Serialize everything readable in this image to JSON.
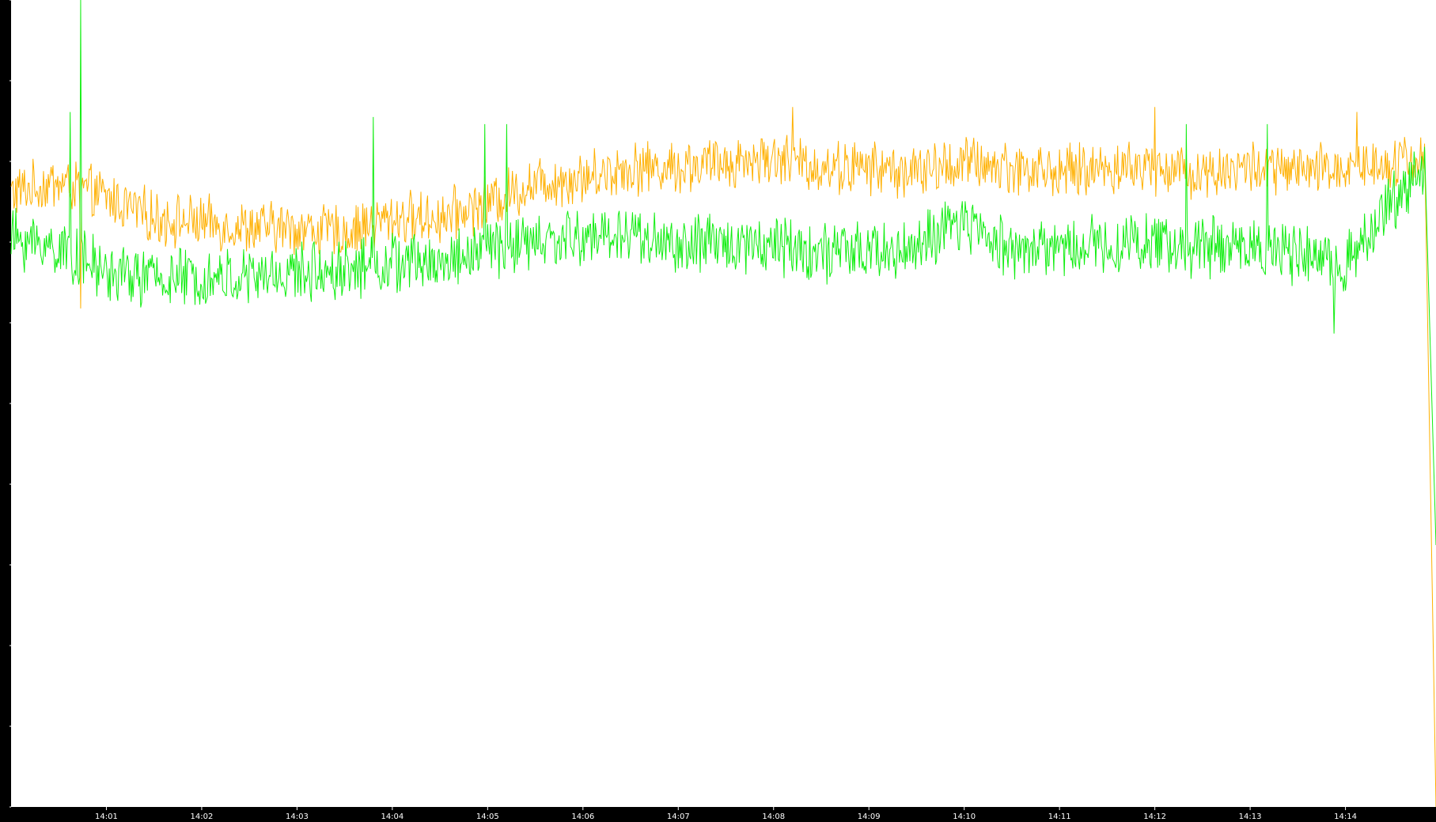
{
  "chart_data": {
    "type": "line",
    "title": "",
    "xlabel": "",
    "ylabel": "",
    "ylim": [
      0,
      8012
    ],
    "y_ticks": [
      "0",
      "801",
      "1602",
      "2403",
      "3204",
      "4006",
      "4807",
      "5608",
      "6409",
      "7210",
      "8012"
    ],
    "x_ticks": [
      "14:01",
      "14:02",
      "14:03",
      "14:04",
      "14:05",
      "14:06",
      "14:07",
      "14:08",
      "14:09",
      "14:10",
      "14:11",
      "14:12",
      "14:13",
      "14:14"
    ],
    "x_range": [
      "14:00:00",
      "14:14:57"
    ],
    "grid": false,
    "legend": "none",
    "series": [
      {
        "color": "#ffb000",
        "profile": [
          [
            "14:00:00",
            6100
          ],
          [
            "14:00:30",
            6200
          ],
          [
            "14:01:00",
            6050
          ],
          [
            "14:01:30",
            5850
          ],
          [
            "14:02:00",
            5800
          ],
          [
            "14:02:30",
            5750
          ],
          [
            "14:03:00",
            5750
          ],
          [
            "14:03:30",
            5700
          ],
          [
            "14:04:00",
            5850
          ],
          [
            "14:04:30",
            5850
          ],
          [
            "14:05:00",
            6000
          ],
          [
            "14:05:30",
            6200
          ],
          [
            "14:06:00",
            6250
          ],
          [
            "14:06:30",
            6350
          ],
          [
            "14:07:00",
            6350
          ],
          [
            "14:07:30",
            6400
          ],
          [
            "14:08:00",
            6450
          ],
          [
            "14:08:30",
            6350
          ],
          [
            "14:09:00",
            6350
          ],
          [
            "14:09:30",
            6300
          ],
          [
            "14:10:00",
            6400
          ],
          [
            "14:10:30",
            6350
          ],
          [
            "14:11:00",
            6300
          ],
          [
            "14:11:30",
            6350
          ],
          [
            "14:12:00",
            6350
          ],
          [
            "14:12:30",
            6300
          ],
          [
            "14:13:00",
            6350
          ],
          [
            "14:13:30",
            6300
          ],
          [
            "14:14:00",
            6350
          ],
          [
            "14:14:50",
            6450
          ],
          [
            "14:14:57",
            0
          ]
        ],
        "spikes": [
          [
            "14:00:44",
            4950
          ],
          [
            "14:08:12",
            6950
          ],
          [
            "14:12:00",
            6950
          ],
          [
            "14:14:07",
            6900
          ]
        ]
      },
      {
        "color": "#11ee11",
        "profile": [
          [
            "14:00:00",
            5650
          ],
          [
            "14:00:30",
            5550
          ],
          [
            "14:01:00",
            5300
          ],
          [
            "14:01:30",
            5250
          ],
          [
            "14:02:00",
            5250
          ],
          [
            "14:02:30",
            5250
          ],
          [
            "14:03:00",
            5300
          ],
          [
            "14:03:30",
            5350
          ],
          [
            "14:04:00",
            5400
          ],
          [
            "14:04:30",
            5400
          ],
          [
            "14:05:00",
            5550
          ],
          [
            "14:05:30",
            5600
          ],
          [
            "14:06:00",
            5650
          ],
          [
            "14:06:30",
            5700
          ],
          [
            "14:07:00",
            5550
          ],
          [
            "14:07:30",
            5600
          ],
          [
            "14:08:00",
            5600
          ],
          [
            "14:08:30",
            5500
          ],
          [
            "14:09:00",
            5500
          ],
          [
            "14:09:30",
            5550
          ],
          [
            "14:10:00",
            5800
          ],
          [
            "14:10:30",
            5550
          ],
          [
            "14:11:00",
            5550
          ],
          [
            "14:11:30",
            5600
          ],
          [
            "14:12:00",
            5600
          ],
          [
            "14:12:30",
            5550
          ],
          [
            "14:13:00",
            5600
          ],
          [
            "14:13:30",
            5450
          ],
          [
            "14:14:00",
            5400
          ],
          [
            "14:14:50",
            6400
          ],
          [
            "14:14:57",
            2600
          ]
        ],
        "spikes": [
          [
            "14:00:44",
            8012
          ],
          [
            "14:00:37",
            6900
          ],
          [
            "14:03:48",
            6850
          ],
          [
            "14:04:58",
            6780
          ],
          [
            "14:05:12",
            6780
          ],
          [
            "14:12:20",
            6780
          ],
          [
            "14:13:11",
            6780
          ],
          [
            "14:13:53",
            4700
          ]
        ]
      }
    ]
  }
}
